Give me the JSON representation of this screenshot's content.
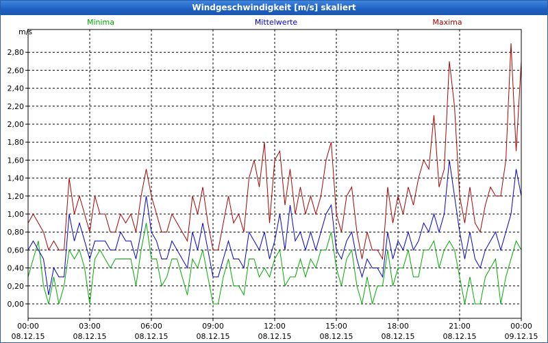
{
  "window": {
    "title": "Windgeschwindigkeit [m/s] skaliert"
  },
  "chart_data": {
    "type": "line",
    "title": "Windgeschwindigkeit [m/s] skaliert",
    "ylabel": "m/s",
    "ylim": [
      0,
      3.0
    ],
    "yticks": [
      "0,00",
      "0,20",
      "0,40",
      "0,60",
      "0,80",
      "1,00",
      "1,20",
      "1,40",
      "1,60",
      "1,80",
      "2,00",
      "2,20",
      "2,40",
      "2,60",
      "2,80"
    ],
    "xlim": [
      0,
      24
    ],
    "xticks": [
      {
        "time": "00:00",
        "date": "08.12.15"
      },
      {
        "time": "03:00",
        "date": "08.12.15"
      },
      {
        "time": "06:00",
        "date": "08.12.15"
      },
      {
        "time": "09:00",
        "date": "08.12.15"
      },
      {
        "time": "12:00",
        "date": "08.12.15"
      },
      {
        "time": "15:00",
        "date": "08.12.15"
      },
      {
        "time": "18:00",
        "date": "08.12.15"
      },
      {
        "time": "21:00",
        "date": "08.12.15"
      },
      {
        "time": "00:00",
        "date": "09.12.15"
      }
    ],
    "grid": true,
    "legend_position": "top",
    "x": [
      0,
      0.25,
      0.5,
      0.75,
      1,
      1.25,
      1.5,
      1.75,
      2,
      2.25,
      2.5,
      2.75,
      3,
      3.25,
      3.5,
      3.75,
      4,
      4.25,
      4.5,
      4.75,
      5,
      5.25,
      5.5,
      5.75,
      6,
      6.25,
      6.5,
      6.75,
      7,
      7.25,
      7.5,
      7.75,
      8,
      8.25,
      8.5,
      8.75,
      9,
      9.25,
      9.5,
      9.75,
      10,
      10.25,
      10.5,
      10.75,
      11,
      11.25,
      11.5,
      11.75,
      12,
      12.25,
      12.5,
      12.75,
      13,
      13.25,
      13.5,
      13.75,
      14,
      14.25,
      14.5,
      14.75,
      15,
      15.25,
      15.5,
      15.75,
      16,
      16.25,
      16.5,
      16.75,
      17,
      17.25,
      17.5,
      17.75,
      18,
      18.25,
      18.5,
      18.75,
      19,
      19.25,
      19.5,
      19.75,
      20,
      20.25,
      20.5,
      20.75,
      21,
      21.25,
      21.5,
      21.75,
      22,
      22.25,
      22.5,
      22.75,
      23,
      23.25,
      23.5,
      23.75,
      24
    ],
    "series": [
      {
        "name": "Minima",
        "color": "#00aa00",
        "values": [
          0.3,
          0.5,
          0.7,
          0.2,
          0,
          0.3,
          0,
          0.2,
          0.6,
          0.5,
          0.6,
          0.4,
          0,
          0.5,
          0.6,
          0.5,
          0.4,
          0.5,
          0.5,
          0.5,
          0.5,
          0.2,
          0.6,
          0.9,
          0.5,
          0.5,
          0.2,
          0.3,
          0.5,
          0.5,
          0.3,
          0.1,
          0.5,
          0.4,
          0.6,
          0.3,
          0,
          0,
          0.3,
          0.5,
          0.2,
          0.2,
          0.1,
          0.5,
          0.5,
          0.3,
          0.4,
          0.3,
          0.5,
          0.6,
          0.2,
          0.3,
          0.3,
          0.5,
          0.3,
          0.5,
          0.4,
          0.6,
          0.6,
          0.8,
          0.4,
          0.2,
          0.5,
          0.6,
          0.2,
          0,
          0.3,
          0,
          0.2,
          0.2,
          0.6,
          0.2,
          0.4,
          0.4,
          0.6,
          0.3,
          0.3,
          0.6,
          0.6,
          0.7,
          0.4,
          0.6,
          0.7,
          0.6,
          0.3,
          0,
          0.3,
          0,
          0,
          0.3,
          0.4,
          0.5,
          0,
          0.3,
          0.5,
          0.7,
          0.6
        ]
      },
      {
        "name": "Mittelwerte",
        "color": "#0000cc",
        "values": [
          0.6,
          0.7,
          0.6,
          0.5,
          0.1,
          0.4,
          0.3,
          0.3,
          1.0,
          0.7,
          0.9,
          0.7,
          0.5,
          0.7,
          0.7,
          0.7,
          0.6,
          0.6,
          0.8,
          0.7,
          0.7,
          0.5,
          0.8,
          1.2,
          0.8,
          0.7,
          0.5,
          0.5,
          0.7,
          0.6,
          0.5,
          0.4,
          0.8,
          0.6,
          0.9,
          0.6,
          0.3,
          0.3,
          0.5,
          0.7,
          0.5,
          0.5,
          0.4,
          0.8,
          0.7,
          0.6,
          0.8,
          0.5,
          0.7,
          1.0,
          0.6,
          1.1,
          0.7,
          0.8,
          0.6,
          0.8,
          0.6,
          0.8,
          1.0,
          1.1,
          0.6,
          0.5,
          0.7,
          0.8,
          0.5,
          0.3,
          0.5,
          0.4,
          0.4,
          0.3,
          0.8,
          0.5,
          0.7,
          0.6,
          0.8,
          0.6,
          0.7,
          0.9,
          0.8,
          1.0,
          0.8,
          1.0,
          1.6,
          1.2,
          0.8,
          0.5,
          0.8,
          0.5,
          0.4,
          0.6,
          0.7,
          0.8,
          0.6,
          0.8,
          1.0,
          1.5,
          1.2
        ]
      },
      {
        "name": "Maxima",
        "color": "#aa0000",
        "values": [
          0.9,
          1.0,
          0.9,
          0.8,
          0.6,
          0.7,
          0.6,
          0.6,
          1.4,
          1.0,
          1.2,
          1.0,
          0.8,
          1.2,
          1.0,
          1.0,
          0.8,
          0.8,
          1.0,
          0.9,
          1.0,
          0.8,
          1.2,
          1.5,
          1.2,
          1.0,
          0.8,
          0.8,
          1.0,
          0.9,
          0.8,
          0.7,
          1.2,
          1.0,
          1.3,
          0.9,
          0.6,
          0.6,
          0.9,
          1.2,
          0.9,
          1.0,
          0.8,
          1.4,
          1.6,
          1.3,
          1.8,
          0.9,
          1.6,
          1.7,
          1.1,
          1.5,
          1.0,
          1.3,
          1.0,
          1.2,
          1.0,
          1.2,
          1.6,
          1.8,
          1.0,
          0.8,
          1.2,
          1.3,
          0.8,
          0.5,
          0.8,
          0.6,
          0.6,
          0.5,
          1.3,
          0.9,
          1.2,
          1.0,
          1.3,
          1.1,
          1.4,
          1.6,
          1.5,
          2.1,
          1.3,
          1.5,
          2.7,
          2.2,
          1.2,
          0.9,
          1.3,
          0.9,
          0.8,
          1.1,
          1.3,
          1.2,
          1.2,
          1.6,
          2.9,
          1.7,
          2.7
        ]
      }
    ]
  }
}
